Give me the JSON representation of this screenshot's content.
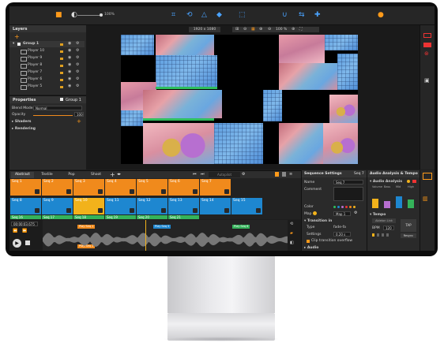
{
  "toolbar": {
    "zoom_value": "100%",
    "resolution": "1920 x 1080",
    "view_zoom": "100 %"
  },
  "layers": {
    "title": "Layers",
    "group": "Group 1",
    "items": [
      "Player 10",
      "Player 9",
      "Player 8",
      "Player 7",
      "Player 6",
      "Player 5"
    ]
  },
  "properties": {
    "title": "Properties",
    "target": "Group 1",
    "blend_label": "Blend Mode",
    "blend_value": "Normal",
    "opacity_label": "Opacity",
    "opacity_value": "100",
    "shaders": "Shaders",
    "rendering": "Rendering"
  },
  "timeline": {
    "tabs": [
      "Abstract",
      "Textile",
      "Pop",
      "Shoot"
    ],
    "autopilot_label": "Autopilot",
    "row1": [
      "Seq 1",
      "Seq 2",
      "Seq 3",
      "Seq 4",
      "Seq 5",
      "Seq 6",
      "Seq 7"
    ],
    "row2": [
      "Seq 8",
      "Seq 9",
      "Seq 10",
      "Seq 11",
      "Seq 12",
      "Seq 13",
      "Seq 14",
      "Seq 15"
    ],
    "row2_foot": [
      "Seq 16",
      "Seq 17",
      "Seq 18",
      "Seq 19",
      "Seq 20",
      "Seq 21"
    ],
    "timecode": "00:00:03.675",
    "clip_markers": [
      "Play Seq 1",
      "Play Seq 5",
      "Play Seq 6",
      "Play Seq 2"
    ],
    "progress": 0.42
  },
  "sequence_settings": {
    "title": "Sequence Settings",
    "seq_label": "Seq 7",
    "name_label": "Name",
    "name_value": "Seq 7",
    "comment_label": "Comment",
    "color_label": "Color",
    "map_label": "Map",
    "map_value": "Map 1",
    "transition_label": "Transition in",
    "type_label": "Type",
    "type_value": "fade-fa",
    "settings_label": "Settings",
    "settings_value": "0.20 s",
    "clip_label": "Clip transition overflow",
    "audio_label": "Audio"
  },
  "audio": {
    "title": "Audio Analysis & Tempo",
    "section": "Audio Analysis",
    "bands": [
      "Volume",
      "Bass",
      "Mid",
      "High"
    ],
    "band_levels": [
      0.55,
      0.4,
      0.7,
      0.5
    ],
    "tempo_label": "Tempo",
    "tempo_link": "Ableton Link",
    "bpm_label": "BPM",
    "bpm_value": "120",
    "tap_label": "TAP",
    "resync_label": "Resync"
  },
  "colors": {
    "accent": "#1e87d0",
    "seq_orange": "#f08a1c",
    "seq_green": "#34b35a",
    "highlight": "#f2b21b"
  }
}
